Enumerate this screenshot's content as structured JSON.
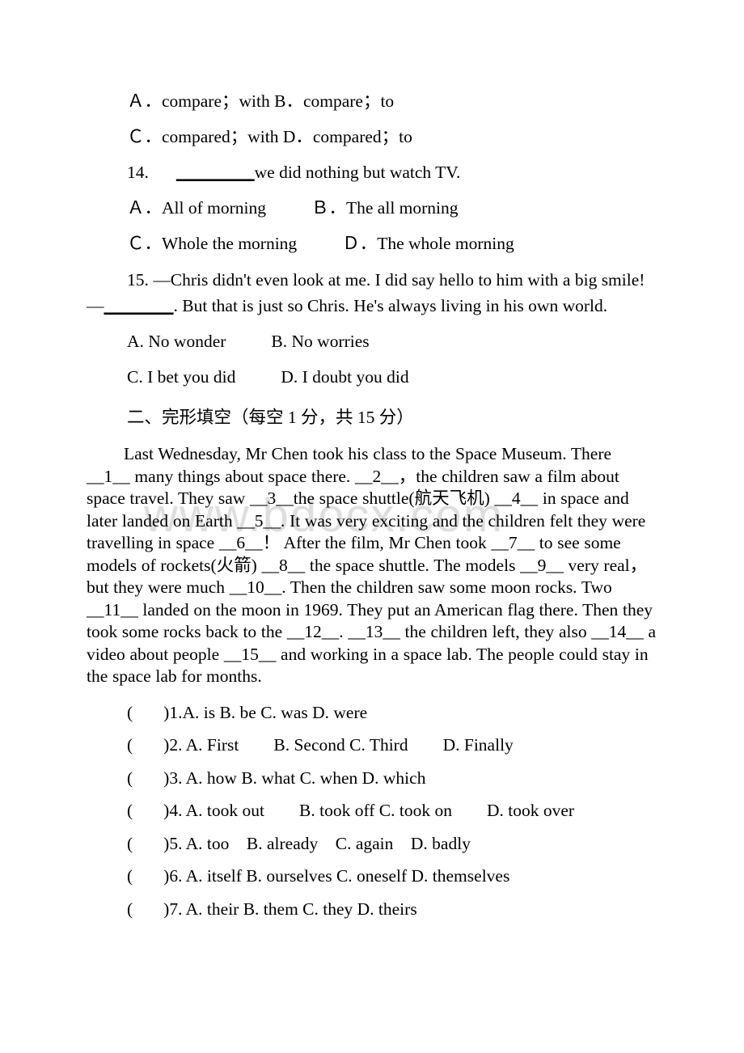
{
  "document": {
    "page_background": "#ffffff",
    "text_color": "#000000",
    "watermark": {
      "text": "www.bdocx.com",
      "color": "#dedede"
    }
  },
  "question_13_options": {
    "line_ab": "Ａ．compare；with B．compare；to",
    "line_cd": "Ｃ．compared；with D．compared；to"
  },
  "question_14": {
    "number_and_stem_pre": "14.",
    "blank": "_________",
    "stem_post": "we did nothing but watch TV.",
    "option_a": "Ａ．All of morning",
    "option_b": "Ｂ．The all morning",
    "option_c": "Ｃ．Whole the morning",
    "option_d": "Ｄ．The whole morning"
  },
  "question_15": {
    "stem_part1": "15. —Chris didn't even look at me. I did say hello to him with a big smile!—",
    "blank": "________",
    "stem_part2": ". But that is just so Chris. He's always living in his own world.",
    "option_a": "A. No wonder",
    "option_b": "B. No worries",
    "option_c": "C. I bet you did",
    "option_d": "D. I doubt you did"
  },
  "section_two": {
    "heading": "二、完形填空（每空 1 分，共 15 分）",
    "passage": "Last Wednesday, Mr Chen took his class to the Space Museum. There __1__ many things about space there. __2__，the children saw a film about space travel. They saw __3__the space shuttle(航天飞机) __4__ in space and later landed on Earth __5__. It was very exciting and the children felt they were travelling in space __6__！ After the film, Mr Chen took __7__ to see some models of rockets(火箭) __8__ the space shuttle. The models __9__ very real，but they were much __10__. Then the children saw some moon rocks. Two __11__ landed on the moon in 1969. They put an American flag there. Then they took some rocks back to the __12__. __13__ the children left, they also __14__ a video about people __15__ and working in a space lab. The people could stay in the space lab for months."
  },
  "cloze_choices": [
    {
      "marker": "(",
      "close": ")",
      "text": "1.A. is B. be C. was D. were"
    },
    {
      "marker": "(",
      "close": ")",
      "text": "2. A. First        B. Second C. Third        D. Finally"
    },
    {
      "marker": "(",
      "close": ")",
      "text": "3. A. how B. what C. when D. which"
    },
    {
      "marker": "(",
      "close": ")",
      "text": "4. A. took out        B. took off C. took on        D. took over"
    },
    {
      "marker": "(",
      "close": ")",
      "text": "5. A. too    B. already    C. again    D. badly"
    },
    {
      "marker": "(",
      "close": ")",
      "text": "6. A. itself B. ourselves C. oneself D. themselves"
    },
    {
      "marker": "(",
      "close": ")",
      "text": "7. A. their B. them C. they D. theirs"
    }
  ]
}
